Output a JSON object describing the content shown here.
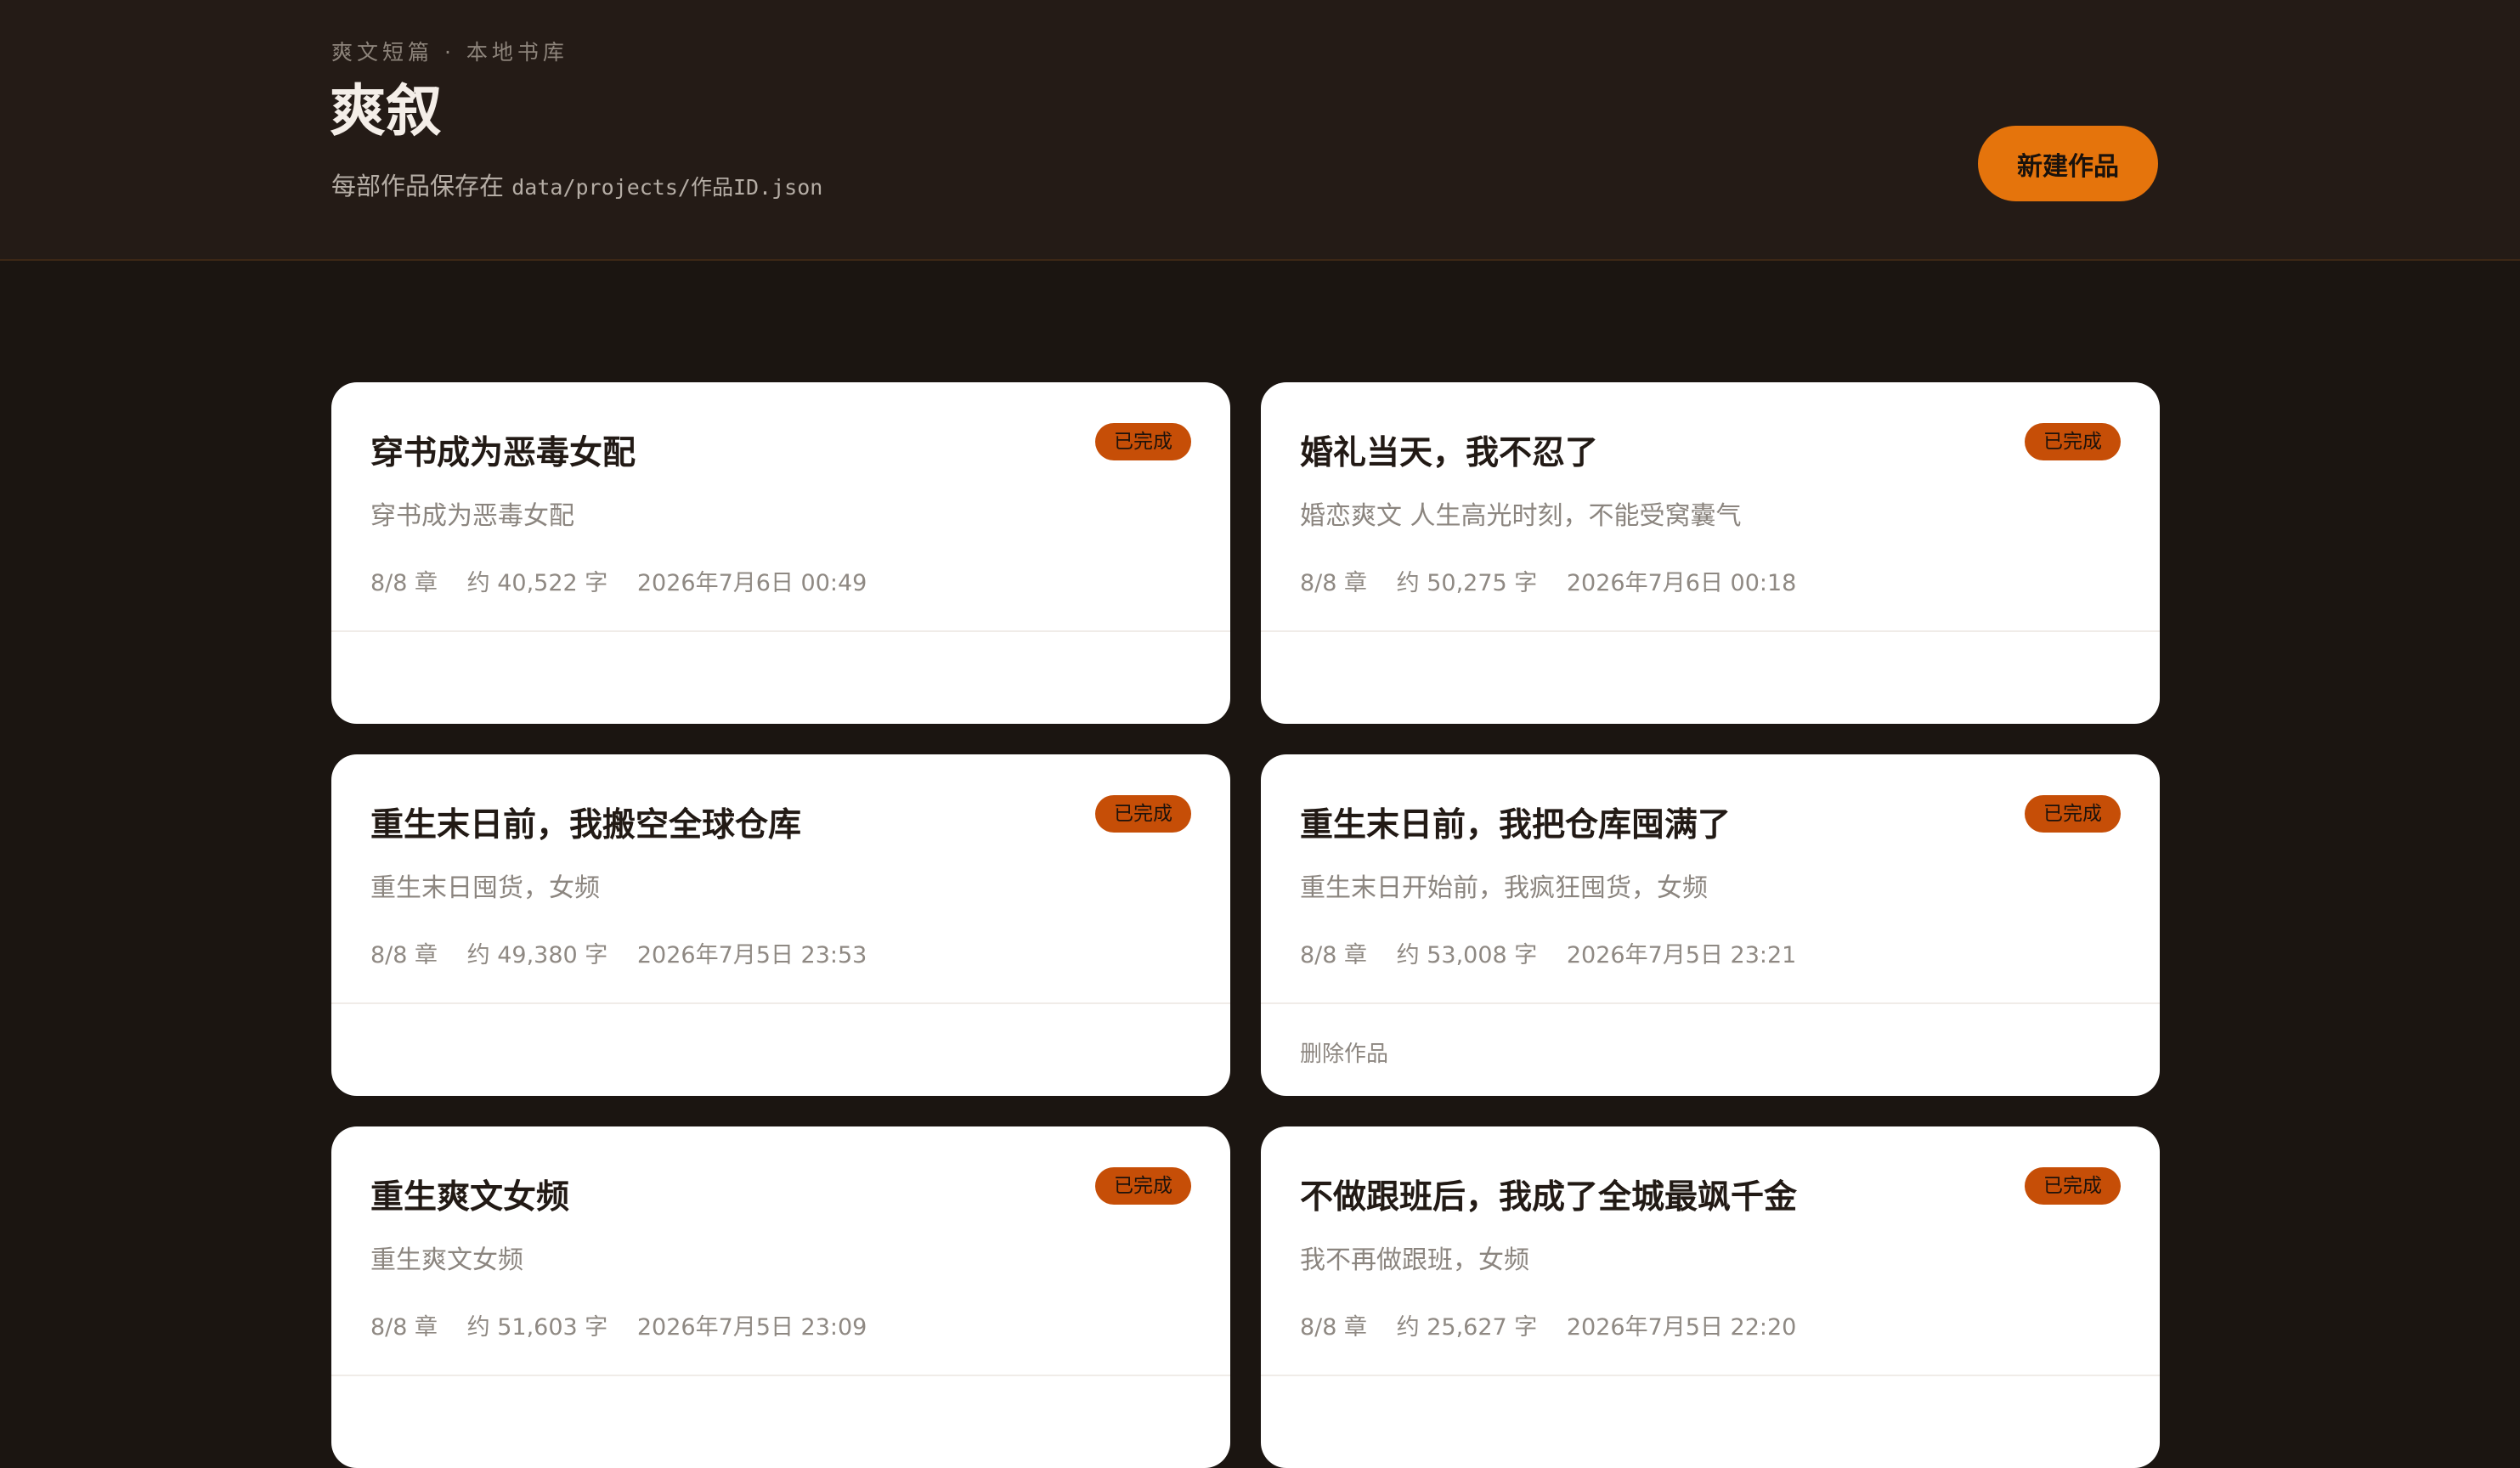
{
  "header": {
    "kicker": "爽文短篇 · 本地书库",
    "title": "爽叙",
    "subtitle_prefix": "每部作品保存在",
    "subtitle_path": "data/projects/作品ID.json",
    "new_button": "新建作品"
  },
  "card_actions": {
    "delete_label": "删除作品"
  },
  "colors": {
    "header_bg": "#241b16",
    "page_bg": "#1b1511",
    "accent": "#e5740c",
    "badge": "#c64e07"
  },
  "projects": [
    {
      "title": "穿书成为恶毒女配",
      "status": "已完成",
      "description": "穿书成为恶毒女配",
      "chapters": "8/8 章",
      "words": "约 40,522 字",
      "updated": "2026年7月6日 00:49"
    },
    {
      "title": "婚礼当天，我不忍了",
      "status": "已完成",
      "description": "婚恋爽文 人生高光时刻，不能受窝囊气",
      "chapters": "8/8 章",
      "words": "约 50,275 字",
      "updated": "2026年7月6日 00:18"
    },
    {
      "title": "重生末日前，我搬空全球仓库",
      "status": "已完成",
      "description": "重生末日囤货，女频",
      "chapters": "8/8 章",
      "words": "约 49,380 字",
      "updated": "2026年7月5日 23:53"
    },
    {
      "title": "重生末日前，我把仓库囤满了",
      "status": "已完成",
      "description": "重生末日开始前，我疯狂囤货，女频",
      "chapters": "8/8 章",
      "words": "约 53,008 字",
      "updated": "2026年7月5日 23:21"
    },
    {
      "title": "重生爽文女频",
      "status": "已完成",
      "description": "重生爽文女频",
      "chapters": "8/8 章",
      "words": "约 51,603 字",
      "updated": "2026年7月5日 23:09"
    },
    {
      "title": "不做跟班后，我成了全城最飒千金",
      "status": "已完成",
      "description": "我不再做跟班，女频",
      "chapters": "8/8 章",
      "words": "约 25,627 字",
      "updated": "2026年7月5日 22:20"
    }
  ]
}
